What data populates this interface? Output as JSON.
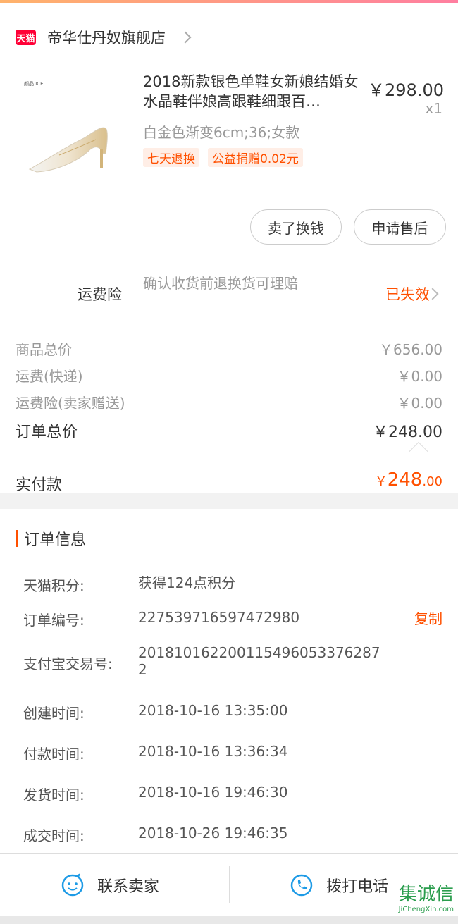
{
  "shop": {
    "badge": "天猫",
    "name": "帝华仕丹奴旗舰店"
  },
  "product": {
    "thumb_brand": "颜品 ICE",
    "title": "2018新款银色单鞋女新娘结婚女水晶鞋伴娘高跟鞋细跟百…",
    "price": "￥298.00",
    "quantity": "x1",
    "spec": "白金色渐变6cm;36;女款",
    "tags": [
      "七天退换",
      "公益捐赠0.02元"
    ]
  },
  "actions": {
    "sell": "卖了换钱",
    "after_sale": "申请售后"
  },
  "insurance": {
    "label": "运费险",
    "desc": "确认收货前退换货可理赔",
    "status": "已失效"
  },
  "summary": {
    "rows": [
      {
        "label": "商品总价",
        "value": "￥656.00"
      },
      {
        "label": "运费(快递)",
        "value": "￥0.00"
      },
      {
        "label": "运费险(卖家赠送)",
        "value": "￥0.00"
      }
    ],
    "total": {
      "label": "订单总价",
      "value": "￥248.00"
    },
    "paid": {
      "label": "实付款",
      "symbol": "￥",
      "integer": "248",
      "decimal": ".00"
    }
  },
  "order_info": {
    "title": "订单信息",
    "copy_label": "复制",
    "rows": [
      {
        "key": "天猫积分:",
        "value": "获得124点积分"
      },
      {
        "key": "订单编号:",
        "value": "227539716597472980"
      },
      {
        "key": "支付宝交易号:",
        "value": "2018101622001154960533762872"
      },
      {
        "key": "创建时间:",
        "value": "2018-10-16 13:35:00"
      },
      {
        "key": "付款时间:",
        "value": "2018-10-16 13:36:34"
      },
      {
        "key": "发货时间:",
        "value": "2018-10-16 19:46:30"
      },
      {
        "key": "成交时间:",
        "value": "2018-10-26 19:46:35"
      }
    ]
  },
  "bottom_bar": {
    "contact_seller": "联系卖家",
    "call_phone": "拨打电话"
  },
  "watermark": {
    "cn": "集诚信",
    "en": "JiChengXin.com"
  },
  "colors": {
    "accent": "#ff5000",
    "tmall": "#ff0036",
    "icon_blue": "#1e9be6"
  }
}
